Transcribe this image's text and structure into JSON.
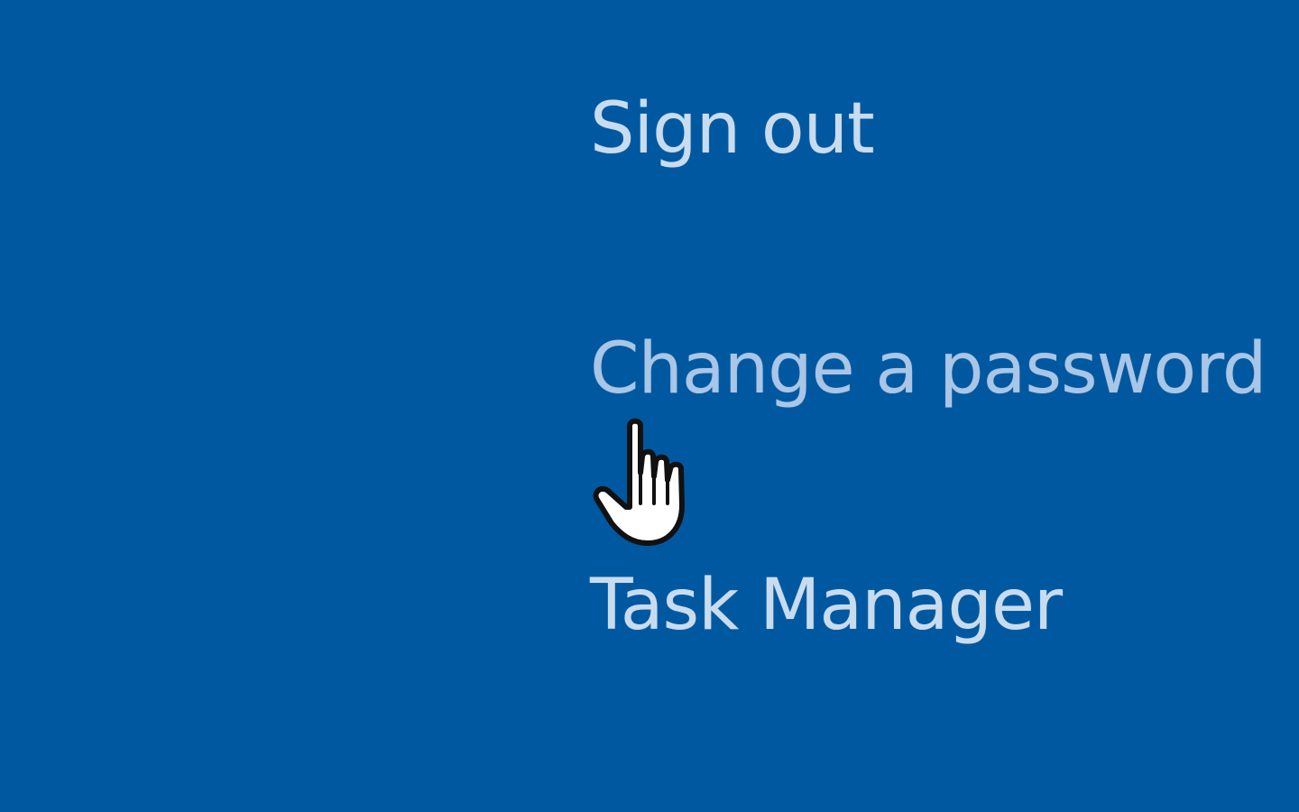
{
  "menu": {
    "items": [
      {
        "label": "Sign out"
      },
      {
        "label": "Change a password"
      },
      {
        "label": "Task Manager"
      }
    ]
  },
  "colors": {
    "background": "#0058a0",
    "item_text": "#c9dcef",
    "item_text_hover": "#a9c6e6"
  },
  "cursor": {
    "icon": "hand-pointer-icon"
  }
}
